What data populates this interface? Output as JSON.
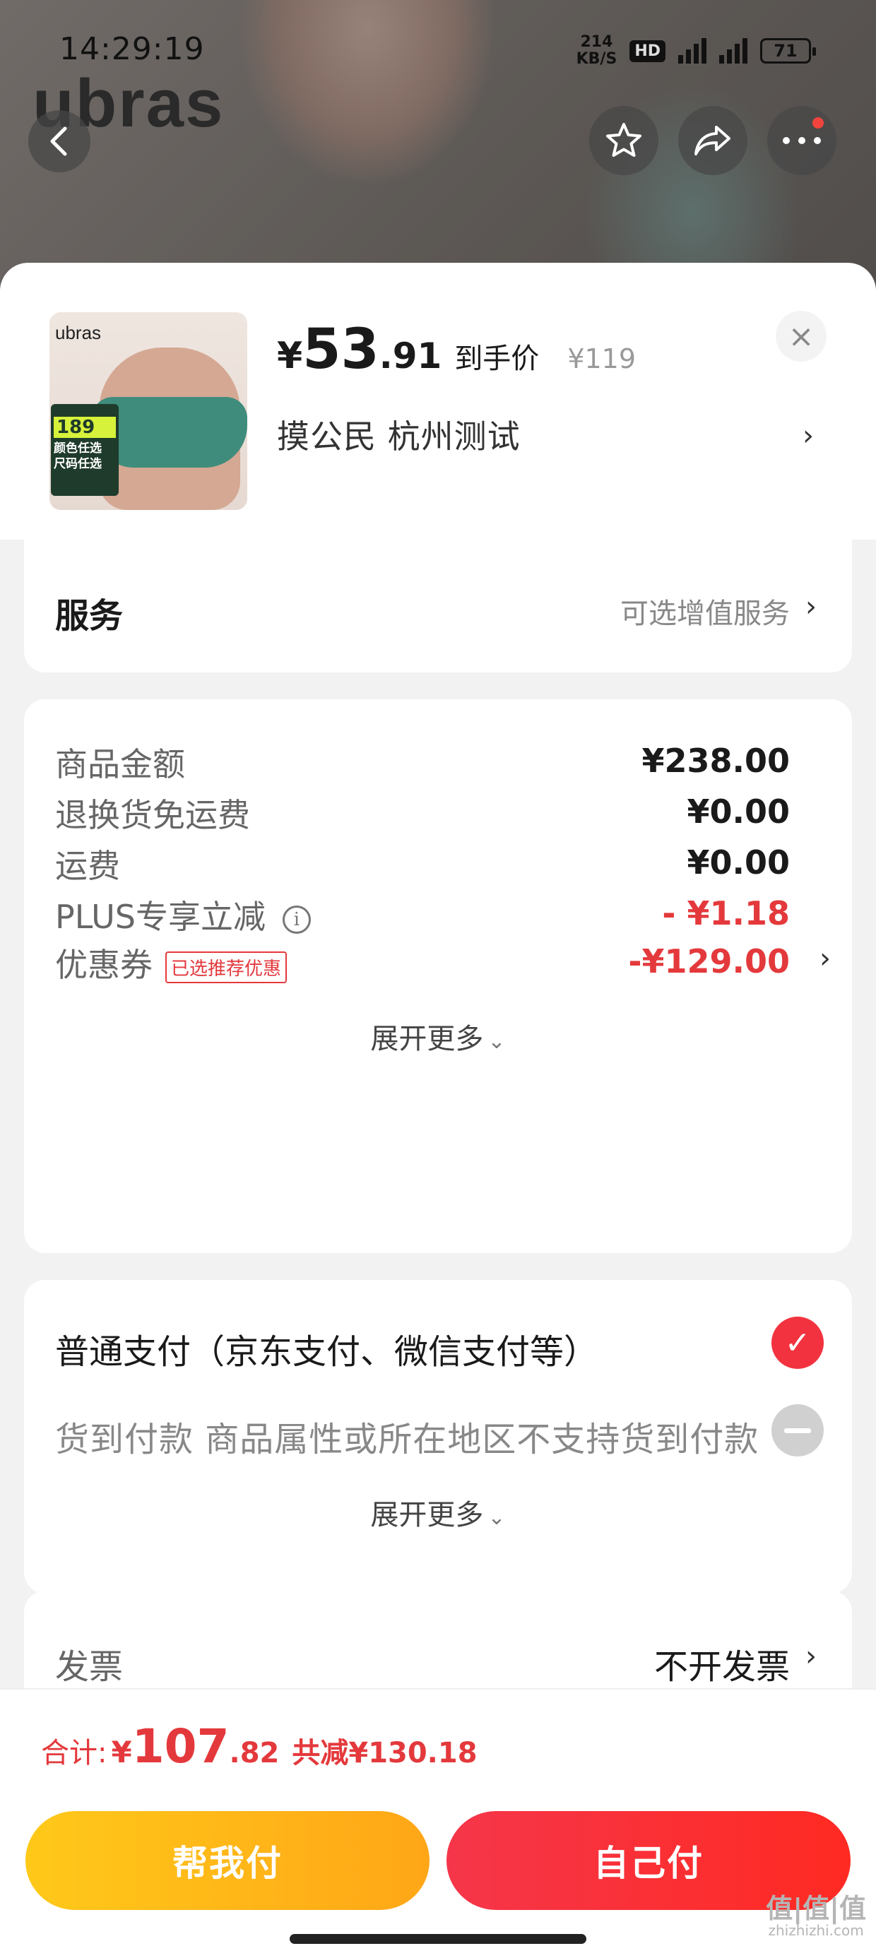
{
  "status_bar": {
    "time": "14:29:19",
    "speed_value": "214",
    "speed_unit": "KB/S",
    "hd": "HD",
    "battery": "71"
  },
  "header": {
    "brand": "ubras"
  },
  "sku": {
    "thumb_brand": "ubras",
    "thumb_price": "189",
    "thumb_line1": "颜色任选",
    "thumb_line2": "尺码任选",
    "price_symbol": "¥",
    "price_int": "53",
    "price_dec": ".91",
    "price_label": "到手价",
    "original_price": "¥119",
    "spec": "摸公民  杭州测试",
    "close": "×",
    "arrow": "›"
  },
  "service": {
    "title": "服务",
    "value": "可选增值服务",
    "arrow": "›"
  },
  "amounts": {
    "rows": [
      {
        "label": "商品金额",
        "value": "¥238.00"
      },
      {
        "label": "退换货免运费",
        "value": "¥0.00"
      },
      {
        "label": "运费",
        "value": "¥0.00"
      },
      {
        "label": "PLUS专享立减",
        "value": "- ¥1.18"
      },
      {
        "label": "优惠券",
        "value": "-¥129.00",
        "tag": "已选推荐优惠"
      }
    ],
    "info_icon": "i",
    "expand": "展开更多",
    "expand_chevron": "⌄"
  },
  "payment": {
    "normal": "普通支付（京东支付、微信支付等）",
    "check": "✓",
    "cod": "货到付款 商品属性或所在地区不支持货到付款",
    "expand": "展开更多",
    "expand_chevron": "⌄"
  },
  "invoice": {
    "label": "发票",
    "value": "不开发票",
    "arrow": "›"
  },
  "footer": {
    "total_label": "合计:",
    "total_yen": "¥",
    "total_int": "107",
    "total_dec": ".82",
    "saved": "共减¥130.18",
    "help_pay": "帮我付",
    "self_pay": "自己付",
    "watermark": "值|值|值",
    "watermark_url": "zhizhizhi.com"
  },
  "colors": {
    "accent_red": "#e4393c",
    "pay_red": "#f5364a",
    "help_yellow": "#ffb518"
  }
}
